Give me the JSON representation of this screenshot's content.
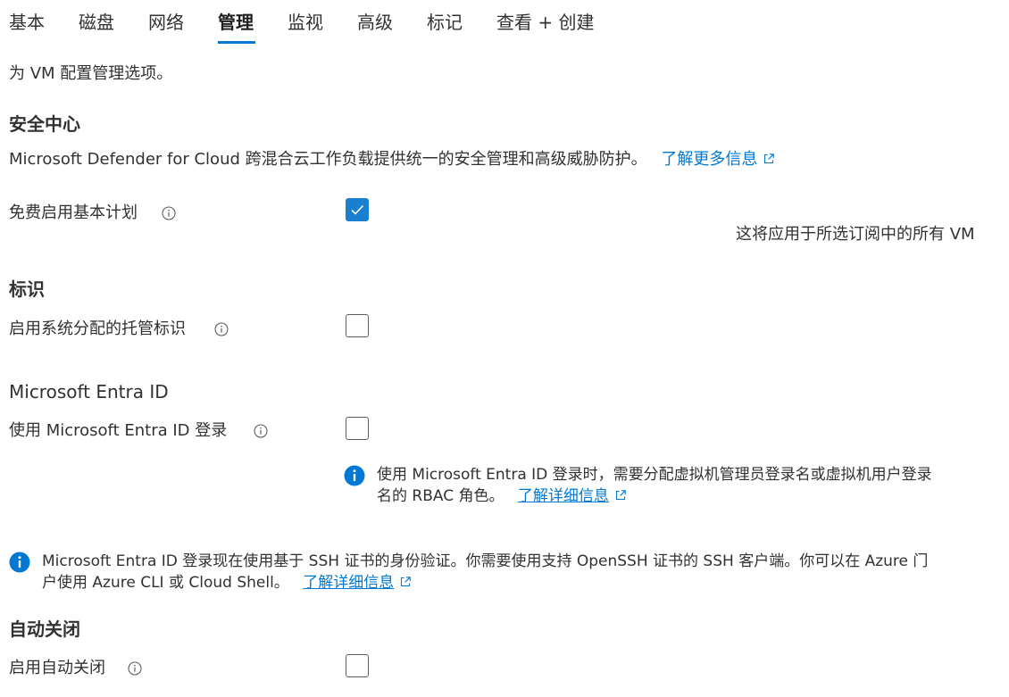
{
  "tabs": [
    {
      "label": "基本",
      "active": false
    },
    {
      "label": "磁盘",
      "active": false
    },
    {
      "label": "网络",
      "active": false
    },
    {
      "label": "管理",
      "active": true
    },
    {
      "label": "监视",
      "active": false
    },
    {
      "label": "高级",
      "active": false
    },
    {
      "label": "标记",
      "active": false
    },
    {
      "label": "查看 + 创建",
      "active": false
    }
  ],
  "intro": "为 VM 配置管理选项。",
  "security": {
    "heading": "安全中心",
    "description": "Microsoft Defender for Cloud 跨混合云工作负载提供统一的安全管理和高级威胁防护。",
    "learn_more": "了解更多信息",
    "basic_plan_label": "免费启用基本计划",
    "basic_plan_checked": true,
    "basic_plan_note": "这将应用于所选订阅中的所有 VM"
  },
  "identity": {
    "heading": "标识",
    "system_identity_label": "启用系统分配的托管标识",
    "system_identity_checked": false
  },
  "entra": {
    "heading": "Microsoft Entra ID",
    "login_label": "使用 Microsoft Entra ID 登录",
    "login_checked": false,
    "info_line1": "使用 Microsoft Entra ID 登录时，需要分配虚拟机管理员登录名或虚拟机用户登录",
    "info_line2": "名的 RBAC 角色。",
    "info_link": "了解详细信息",
    "ssh_line1": "Microsoft Entra ID 登录现在使用基于 SSH 证书的身份验证。你需要使用支持 OpenSSH 证书的 SSH 客户端。你可以在 Azure 门",
    "ssh_line2": "户使用 Azure CLI 或 Cloud Shell。",
    "ssh_link": "了解详细信息"
  },
  "autoshutdown": {
    "heading": "自动关闭",
    "enable_label": "启用自动关闭",
    "enable_checked": false
  },
  "colors": {
    "accent": "#0078d4",
    "checkbox_checked": "#1a7fd0",
    "text": "#323130"
  }
}
